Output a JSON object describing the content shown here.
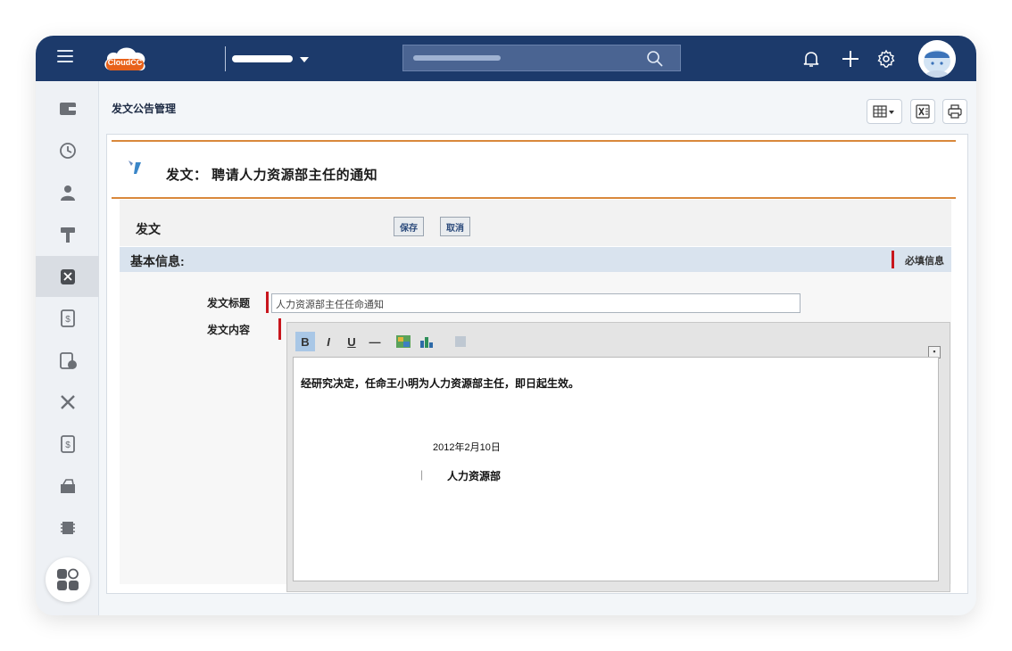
{
  "topbar": {
    "logo_text": "CloudCC",
    "menu_icon": "hamburger-menu-icon",
    "search_icon": "search-icon",
    "bell_icon": "bell-icon",
    "plus_icon": "plus-icon",
    "settings_icon": "gear-icon",
    "avatar_icon": "user-avatar-icon",
    "brand_color": "#1c3a6b"
  },
  "sidebar": {
    "items": [
      {
        "icon": "wallet-icon"
      },
      {
        "icon": "history-clock-icon"
      },
      {
        "icon": "person-icon"
      },
      {
        "icon": "hammer-icon"
      },
      {
        "icon": "tools-badge-icon",
        "active": true
      },
      {
        "icon": "dollar-document-icon"
      },
      {
        "icon": "clipboard-settings-icon"
      },
      {
        "icon": "wrench-screwdriver-icon"
      },
      {
        "icon": "dollar-document-icon"
      },
      {
        "icon": "purse-icon"
      },
      {
        "icon": "chip-icon"
      }
    ],
    "bottom_icon": "app-grid-icon"
  },
  "page": {
    "title": "发文公告管理",
    "toolbar_icons": [
      "table-view-icon",
      "excel-export-icon",
      "print-icon"
    ]
  },
  "record": {
    "title": "发文： 聘请人力资源部主任的通知",
    "section_label": "发文",
    "save_label": "保存",
    "cancel_label": "取消",
    "basic_info_label": "基本信息:",
    "required_note": "必填信息",
    "field_title_label": "发文标题",
    "field_title_value": "人力资源部主任任命通知",
    "field_content_label": "发文内容",
    "editor_tools": [
      "B",
      "I",
      "U",
      "—"
    ],
    "body_lines": [
      "经研究决定，任命王小明为人力资源部主任，即日起生效。",
      "2012年2月10日",
      "人力资源部"
    ],
    "accent_color": "#d9883b",
    "required_color": "#c8161d"
  }
}
